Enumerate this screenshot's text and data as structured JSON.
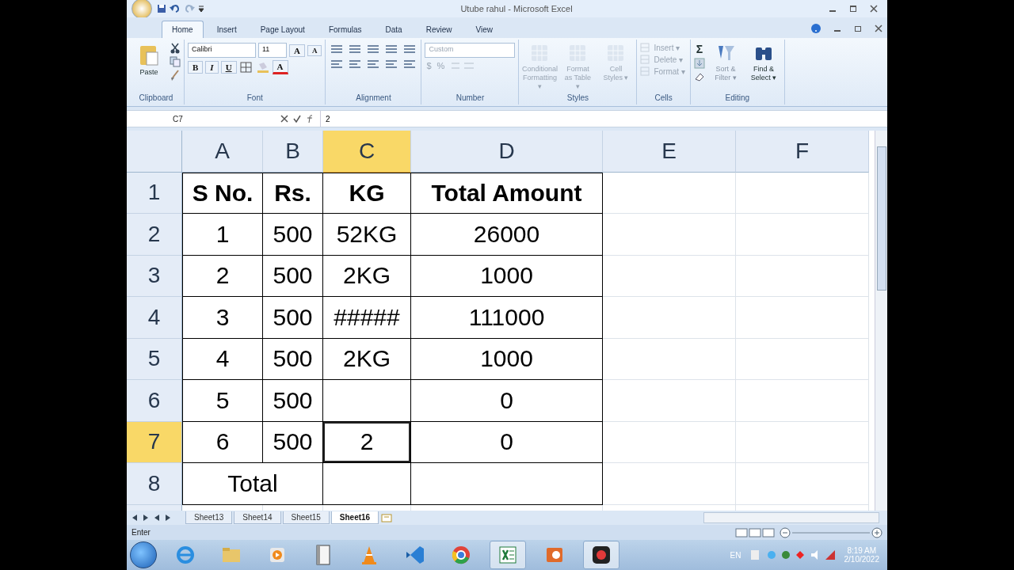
{
  "window": {
    "title": "Utube rahul - Microsoft Excel"
  },
  "tabs": [
    {
      "label": "Home",
      "selected": true
    },
    {
      "label": "Insert",
      "selected": false
    },
    {
      "label": "Page Layout",
      "selected": false
    },
    {
      "label": "Formulas",
      "selected": false
    },
    {
      "label": "Data",
      "selected": false
    },
    {
      "label": "Review",
      "selected": false
    },
    {
      "label": "View",
      "selected": false
    }
  ],
  "ribbon": [
    {
      "kind": "clipboard",
      "label": "Clipboard",
      "disabled": false,
      "commands": [
        "Paste"
      ]
    },
    {
      "kind": "font",
      "label": "Font",
      "disabled": false,
      "font": "Calibri",
      "size": "11",
      "glyphs": [
        "A",
        "A",
        "A"
      ],
      "buttons": [
        "B",
        "I",
        "U"
      ]
    },
    {
      "kind": "alignment",
      "label": "Alignment",
      "disabled": false
    },
    {
      "kind": "number",
      "label": "Number",
      "disabled": true,
      "format": "Custom",
      "buttons": [
        "$",
        "%"
      ]
    },
    {
      "kind": "styles",
      "label": "Styles",
      "disabled": true,
      "commands": [
        "Conditional Formatting ▾",
        "Format as Table ▾",
        "Cell Styles ▾"
      ]
    },
    {
      "kind": "cells",
      "label": "Cells",
      "disabled": true,
      "commands": [
        "Insert ▾",
        "Delete ▾",
        "Format ▾"
      ]
    },
    {
      "kind": "editing",
      "label": "Editing",
      "disabled": false,
      "symbol": "Σ",
      "commands": [
        "Sort & Filter ▾",
        "Find & Select ▾"
      ]
    }
  ],
  "formula_bar": {
    "name_box": "C7",
    "formula": "2"
  },
  "columns": [
    {
      "label": "A",
      "selected": false
    },
    {
      "label": "B",
      "selected": false
    },
    {
      "label": "C",
      "selected": true
    },
    {
      "label": "D",
      "selected": false
    },
    {
      "label": "E",
      "selected": false
    },
    {
      "label": "F",
      "selected": false
    }
  ],
  "rows": [
    {
      "header": "1",
      "selected": false,
      "bold": true,
      "cells": [
        {
          "text": "S No."
        },
        {
          "text": "Rs."
        },
        {
          "text": "KG"
        },
        {
          "text": "Total Amount"
        }
      ]
    },
    {
      "header": "2",
      "selected": false,
      "bold": false,
      "cells": [
        {
          "text": "1"
        },
        {
          "text": "500"
        },
        {
          "text": "52KG"
        },
        {
          "text": "26000"
        }
      ]
    },
    {
      "header": "3",
      "selected": false,
      "bold": false,
      "cells": [
        {
          "text": "2"
        },
        {
          "text": "500"
        },
        {
          "text": "2KG"
        },
        {
          "text": "1000"
        }
      ]
    },
    {
      "header": "4",
      "selected": false,
      "bold": false,
      "cells": [
        {
          "text": "3"
        },
        {
          "text": "500"
        },
        {
          "text": "#####"
        },
        {
          "text": "111000"
        }
      ]
    },
    {
      "header": "5",
      "selected": false,
      "bold": false,
      "cells": [
        {
          "text": "4"
        },
        {
          "text": "500"
        },
        {
          "text": "2KG"
        },
        {
          "text": "1000"
        }
      ]
    },
    {
      "header": "6",
      "selected": false,
      "bold": false,
      "cells": [
        {
          "text": "5"
        },
        {
          "text": "500"
        },
        {},
        {
          "text": "0"
        }
      ]
    },
    {
      "header": "7",
      "selected": true,
      "bold": false,
      "cells": [
        {
          "text": "6"
        },
        {
          "text": "500"
        },
        {
          "text": "2",
          "selected": true
        },
        {
          "text": "0"
        }
      ]
    },
    {
      "header": "8",
      "selected": false,
      "bold": false,
      "cells": [
        {
          "text": "Total",
          "merged": true
        },
        {},
        {}
      ]
    }
  ],
  "sheets": [
    {
      "label": "Sheet13",
      "selected": false
    },
    {
      "label": "Sheet14",
      "selected": false
    },
    {
      "label": "Sheet15",
      "selected": false
    },
    {
      "label": "Sheet16",
      "selected": true
    }
  ],
  "status_bar": {
    "mode": "Enter"
  },
  "taskbar": {
    "apps": [
      {
        "kind": "ie",
        "active": false
      },
      {
        "kind": "folder",
        "active": false
      },
      {
        "kind": "media",
        "active": false
      },
      {
        "kind": "book",
        "active": false
      },
      {
        "kind": "cone",
        "active": false
      },
      {
        "kind": "code",
        "active": false
      },
      {
        "kind": "chrome",
        "active": false
      },
      {
        "kind": "excel",
        "active": true
      },
      {
        "kind": "slides",
        "active": false
      },
      {
        "kind": "recorder",
        "active": true
      }
    ],
    "language": "EN",
    "time": "8:19 AM",
    "date": "2/10/2022"
  }
}
